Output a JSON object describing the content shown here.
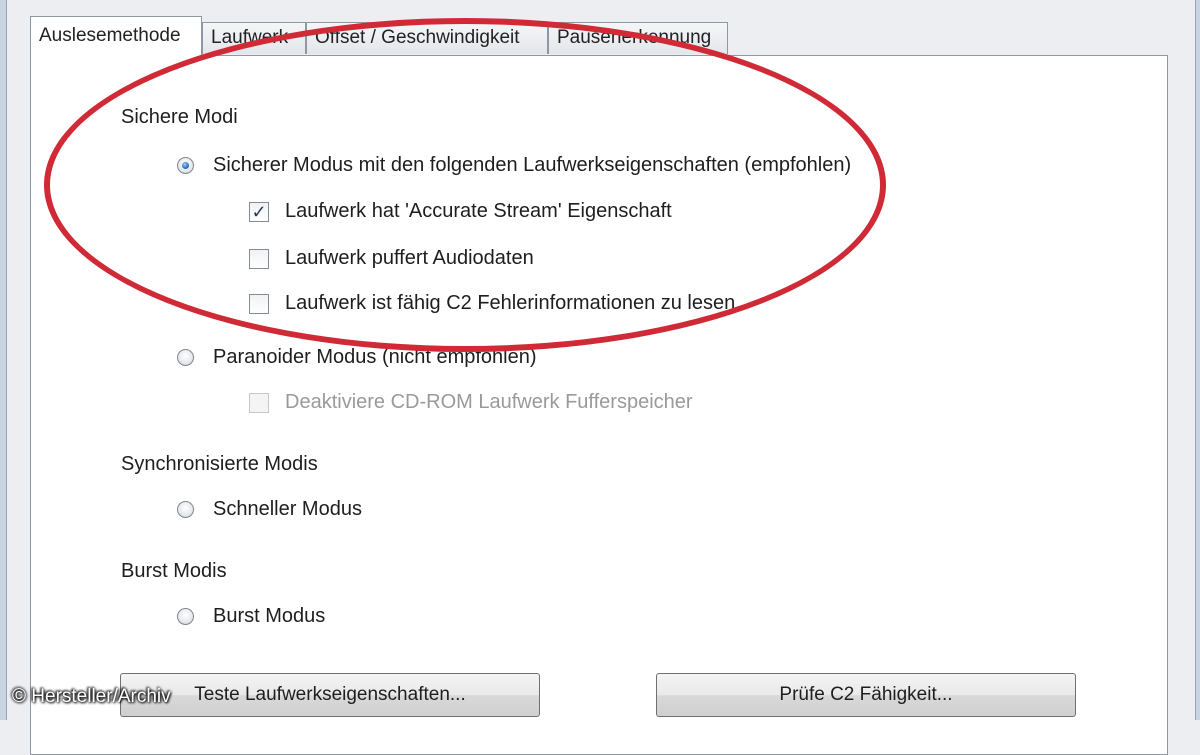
{
  "tabs": [
    {
      "label": "Auslesemethode",
      "active": true
    },
    {
      "label": "Laufwerk",
      "active": false
    },
    {
      "label": "Offset / Geschwindigkeit",
      "active": false
    },
    {
      "label": "Pausenerkennung",
      "active": false
    }
  ],
  "sections": {
    "safe": {
      "title": "Sichere Modi",
      "secure_mode": {
        "label": "Sicherer Modus mit den folgenden Laufwerkseigenschaften (empfohlen)",
        "selected": true
      },
      "accurate_stream": {
        "label": "Laufwerk hat 'Accurate Stream' Eigenschaft",
        "checked": true
      },
      "caches_audio": {
        "label": "Laufwerk puffert Audiodaten",
        "checked": false
      },
      "c2_capable": {
        "label": "Laufwerk ist fähig C2 Fehlerinformationen zu lesen",
        "checked": false
      },
      "paranoid_mode": {
        "label": "Paranoider Modus (nicht empfohlen)",
        "selected": false
      },
      "disable_cache": {
        "label": "Deaktiviere CD-ROM Laufwerk Fufferspeicher",
        "checked": false,
        "disabled": true
      }
    },
    "sync": {
      "title": "Synchronisierte Modis",
      "fast_mode": {
        "label": "Schneller Modus",
        "selected": false
      }
    },
    "burst": {
      "title": "Burst Modis",
      "burst_mode": {
        "label": "Burst Modus",
        "selected": false
      }
    }
  },
  "buttons": {
    "test": "Teste Laufwerkseigenschaften...",
    "c2": "Prüfe C2 Fähigkeit..."
  },
  "copyright": "© Hersteller/Archiv",
  "colors": {
    "highlight": "#cf2a36",
    "radio_dot": "#2a6fbf"
  },
  "check_glyph": "✓"
}
